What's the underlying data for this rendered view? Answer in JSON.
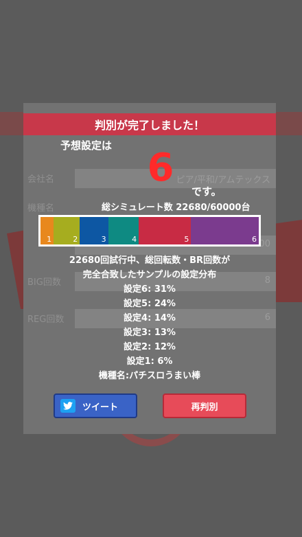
{
  "dialog": {
    "title": "判別が完了しました！",
    "prediction_label": "予想設定は",
    "prediction_value": "6",
    "prediction_suffix": "です。",
    "simulation_total": "総シミュレート数 22680/60000台",
    "distribution": [
      {
        "label": "1",
        "percent": 6,
        "color": "#e8881d"
      },
      {
        "label": "2",
        "percent": 12,
        "color": "#a6ad1f"
      },
      {
        "label": "3",
        "percent": 13,
        "color": "#0d57a3"
      },
      {
        "label": "4",
        "percent": 14,
        "color": "#0e8a82"
      },
      {
        "label": "5",
        "percent": 24,
        "color": "#c82b44"
      },
      {
        "label": "6",
        "percent": 31,
        "color": "#7b3b8e"
      }
    ],
    "stats_lines": [
      "22680回試行中、総回転数・BR回数が",
      "完全合致したサンプルの設定分布",
      "設定6: 31%",
      "設定5: 24%",
      "設定4: 14%",
      "設定3: 13%",
      "設定2: 12%",
      "設定1: 6%",
      "機種名:パチスロうまい棒"
    ],
    "tweet_button": "ツイート",
    "rejudge_button": "再判別"
  },
  "background_form": {
    "company_label": "会社名",
    "company_value": "ピア/平和/アムテックス",
    "model_label": "機種名",
    "big_label": "BIG回数",
    "big_value": "8",
    "reg_label": "REG回数",
    "reg_value": "6",
    "spin_value": "00"
  },
  "colors": {
    "header": "#c8384a",
    "prediction": "#ff2a2a",
    "tweet": "#3a63c6",
    "rejudge": "#e74b59"
  },
  "icons": {
    "tweet": "twitter-bird-icon"
  }
}
